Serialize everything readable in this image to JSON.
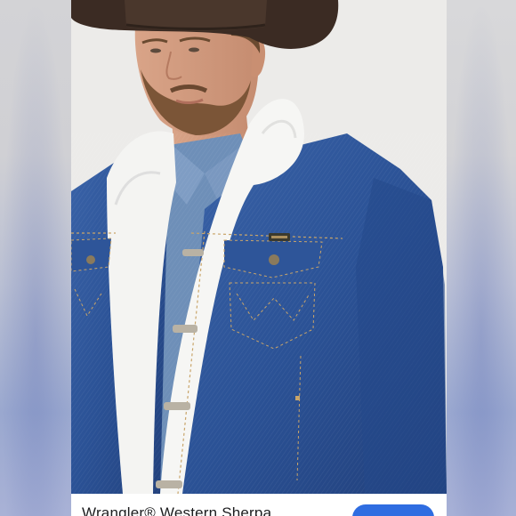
{
  "product": {
    "title": "Wrangler® Western Sherpa",
    "photo_label": "Man wearing a blue denim jacket with white sherpa collar and brown cowboy hat"
  },
  "colors": {
    "background_left": "#d0d0d4",
    "background_right": "#d3d3d6",
    "card": "#ffffff",
    "denim": "#2a4e8f",
    "sherpa": "#f4f4f2",
    "hat": "#3a2a22",
    "button": "#2f6de1"
  },
  "icons": {
    "brand_patch": "wrangler-patch-icon"
  }
}
